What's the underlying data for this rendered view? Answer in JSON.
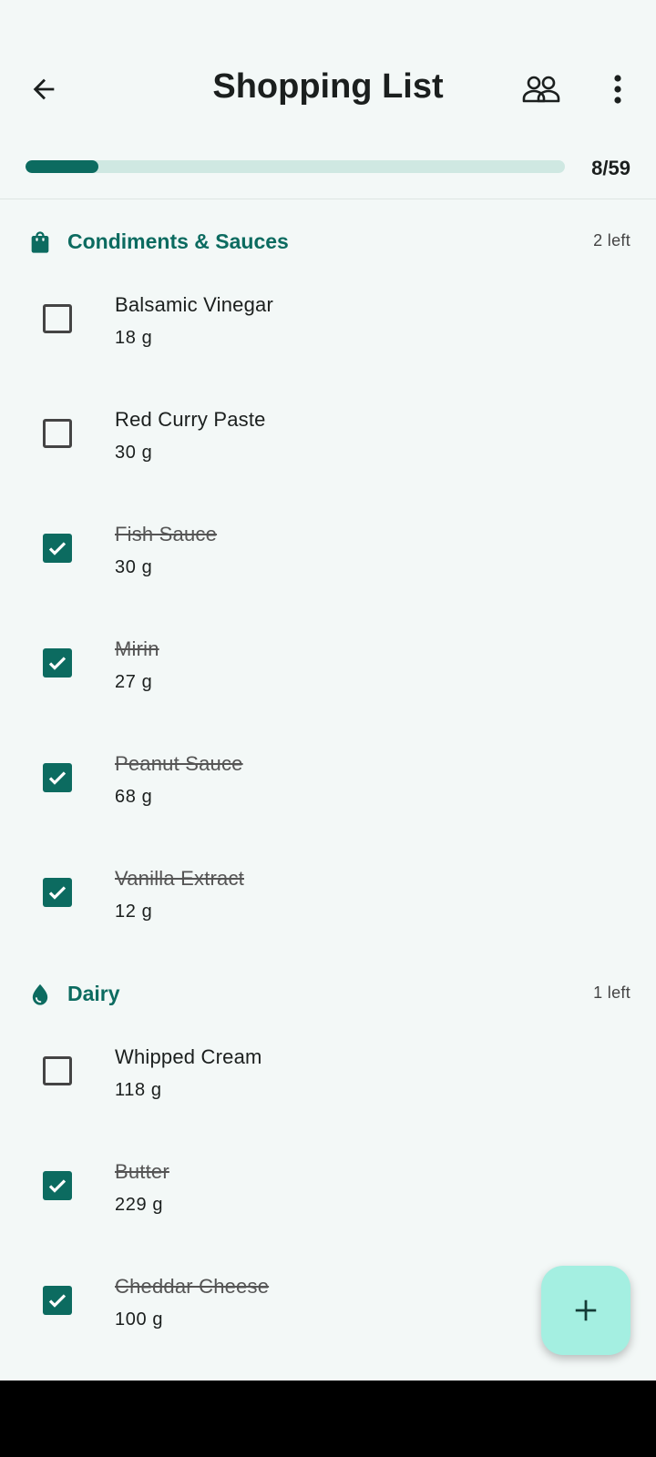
{
  "header": {
    "title": "Shopping List"
  },
  "progress": {
    "checked": 8,
    "total": 59,
    "label": "8/59"
  },
  "colors": {
    "accent": "#0c6b60",
    "track": "#cfe8e2",
    "fab": "#a4efe1",
    "background": "#f3f8f7"
  },
  "sections": [
    {
      "name": "Condiments & Sauces",
      "remaining": "2 left",
      "icon": "shopping-bag-icon",
      "items": [
        {
          "name": "Balsamic Vinegar",
          "qty": "18 g",
          "checked": false
        },
        {
          "name": "Red Curry Paste",
          "qty": "30 g",
          "checked": false
        },
        {
          "name": "Fish Sauce",
          "qty": "30 g",
          "checked": true
        },
        {
          "name": "Mirin",
          "qty": "27 g",
          "checked": true
        },
        {
          "name": "Peanut Sauce",
          "qty": "68 g",
          "checked": true
        },
        {
          "name": "Vanilla Extract",
          "qty": "12 g",
          "checked": true
        }
      ]
    },
    {
      "name": "Dairy",
      "remaining": "1 left",
      "icon": "water-drop-icon",
      "items": [
        {
          "name": "Whipped Cream",
          "qty": "118 g",
          "checked": false
        },
        {
          "name": "Butter",
          "qty": "229 g",
          "checked": true
        },
        {
          "name": "Cheddar Cheese",
          "qty": "100 g",
          "checked": true
        }
      ]
    }
  ]
}
